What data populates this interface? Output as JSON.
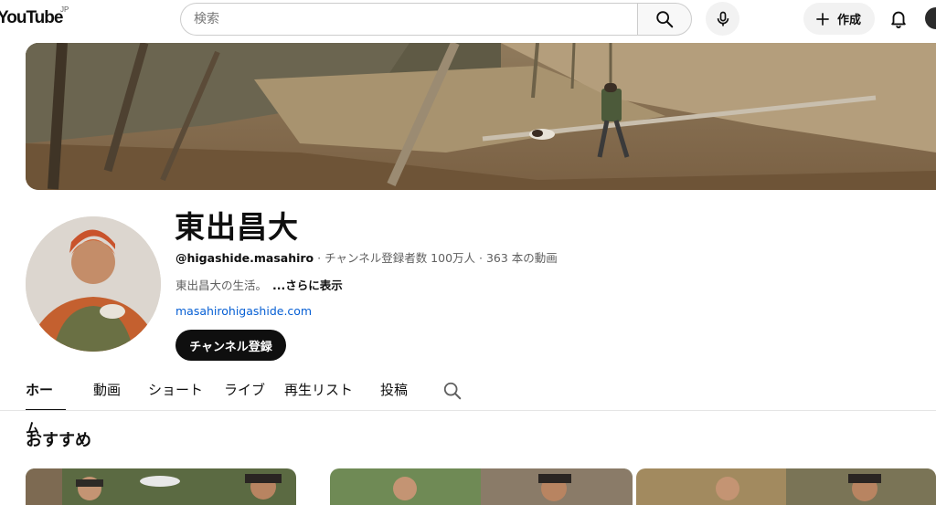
{
  "header": {
    "logo_text": "YouTube",
    "logo_region": "JP",
    "search_placeholder": "検索",
    "create_label": "作成"
  },
  "channel": {
    "name": "東出昌大",
    "handle": "@higashide.masahiro",
    "separator": " · ",
    "subscribers": "チャンネル登録者数 100万人",
    "video_count": "363 本の動画",
    "description": "東出昌大の生活。",
    "more_label": "...さらに表示",
    "link": "masahirohigashide.com",
    "subscribe_label": "チャンネル登録"
  },
  "tabs": [
    {
      "label": "ホーム",
      "active": true
    },
    {
      "label": "動画",
      "active": false
    },
    {
      "label": "ショート",
      "active": false
    },
    {
      "label": "ライブ",
      "active": false
    },
    {
      "label": "再生リスト",
      "active": false
    },
    {
      "label": "投稿",
      "active": false
    }
  ],
  "section": {
    "title": "おすすめ"
  },
  "colors": {
    "link": "#065fd4",
    "text": "#0f0f0f",
    "secondary": "#606060"
  }
}
